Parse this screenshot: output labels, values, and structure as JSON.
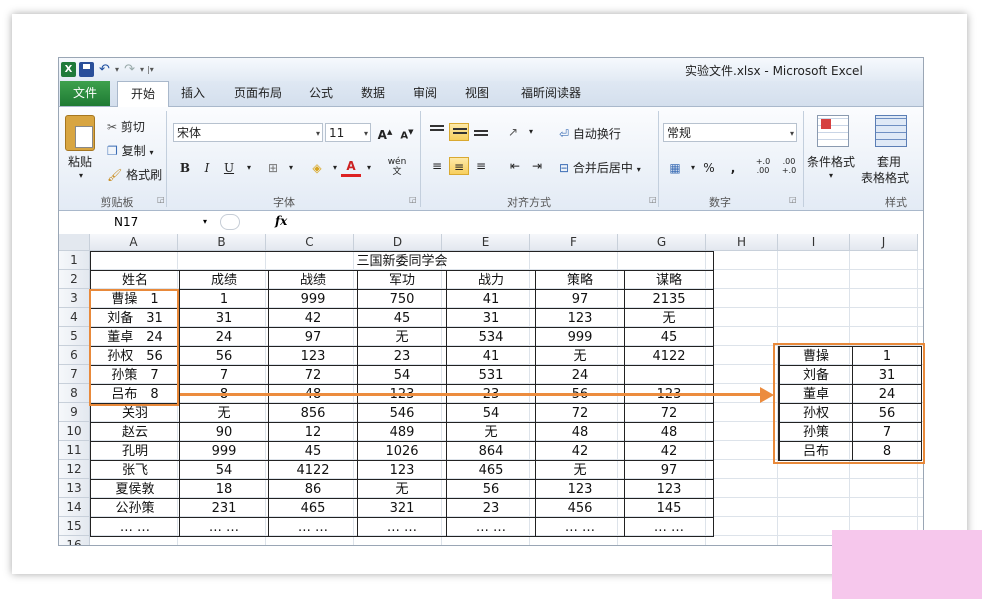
{
  "window": {
    "title": "实验文件.xlsx - Microsoft Excel"
  },
  "tabs": [
    {
      "label": "文件"
    },
    {
      "label": "开始"
    },
    {
      "label": "插入"
    },
    {
      "label": "页面布局"
    },
    {
      "label": "公式"
    },
    {
      "label": "数据"
    },
    {
      "label": "审阅"
    },
    {
      "label": "视图"
    },
    {
      "label": "福昕阅读器"
    }
  ],
  "ribbon": {
    "clipboard": {
      "paste": "粘贴",
      "cut": "剪切",
      "copy": "复制",
      "format_painter": "格式刷",
      "group": "剪贴板"
    },
    "font": {
      "name": "宋体",
      "size": "11",
      "bold": "B",
      "italic": "I",
      "underline": "U",
      "group": "字体",
      "grow": "A",
      "shrink": "A",
      "font_color": "A",
      "phonetic": "wén 文"
    },
    "alignment": {
      "wrap": "自动换行",
      "merge": "合并后居中",
      "group": "对齐方式"
    },
    "number": {
      "format": "常规",
      "percent": "%",
      "comma": ",",
      "group": "数字",
      "inc": "+.0 .00",
      "dec": ".00 +.0"
    },
    "styles": {
      "conditional": "条件格式",
      "table1": "套用",
      "table2": "表格格式",
      "group": "样式"
    }
  },
  "formula_bar": {
    "name_box": "N17",
    "fx": "fx",
    "value": ""
  },
  "columns": [
    "A",
    "B",
    "C",
    "D",
    "E",
    "F",
    "G",
    "H",
    "I",
    "J"
  ],
  "rows": [
    "1",
    "2",
    "3",
    "4",
    "5",
    "6",
    "7",
    "8",
    "9",
    "10",
    "11",
    "12",
    "13",
    "14",
    "15",
    "16"
  ],
  "sheet": {
    "title": "三国新委同学会",
    "headers": [
      "姓名",
      "成绩",
      "战绩",
      "军功",
      "战力",
      "策略",
      "谋略"
    ],
    "data": [
      [
        "曹操　1",
        "1",
        "999",
        "750",
        "41",
        "97",
        "2135"
      ],
      [
        "刘备　31",
        "31",
        "42",
        "45",
        "31",
        "123",
        "无"
      ],
      [
        "董卓　24",
        "24",
        "97",
        "无",
        "534",
        "999",
        "45"
      ],
      [
        "孙权　56",
        "56",
        "123",
        "23",
        "41",
        "无",
        "4122"
      ],
      [
        "孙策　7",
        "7",
        "72",
        "54",
        "531",
        "24",
        ""
      ],
      [
        "吕布　8",
        "8",
        "48",
        "123",
        "23",
        "56",
        "123"
      ],
      [
        "关羽",
        "无",
        "856",
        "546",
        "54",
        "72",
        "72"
      ],
      [
        "赵云",
        "90",
        "12",
        "489",
        "无",
        "48",
        "48"
      ],
      [
        "孔明",
        "999",
        "45",
        "1026",
        "864",
        "42",
        "42"
      ],
      [
        "张飞",
        "54",
        "4122",
        "123",
        "465",
        "无",
        "97"
      ],
      [
        "夏侯敦",
        "18",
        "86",
        "无",
        "56",
        "123",
        "123"
      ],
      [
        "公孙策",
        "231",
        "465",
        "321",
        "23",
        "456",
        "145"
      ],
      [
        "… …",
        "… …",
        "… …",
        "… …",
        "… …",
        "… …",
        "… …"
      ]
    ]
  },
  "result": [
    [
      "曹操",
      "1"
    ],
    [
      "刘备",
      "31"
    ],
    [
      "董卓",
      "24"
    ],
    [
      "孙权",
      "56"
    ],
    [
      "孙策",
      "7"
    ],
    [
      "吕布",
      "8"
    ]
  ],
  "colors": {
    "highlight": "#e8893a",
    "file_tab": "#2a8c3e"
  }
}
